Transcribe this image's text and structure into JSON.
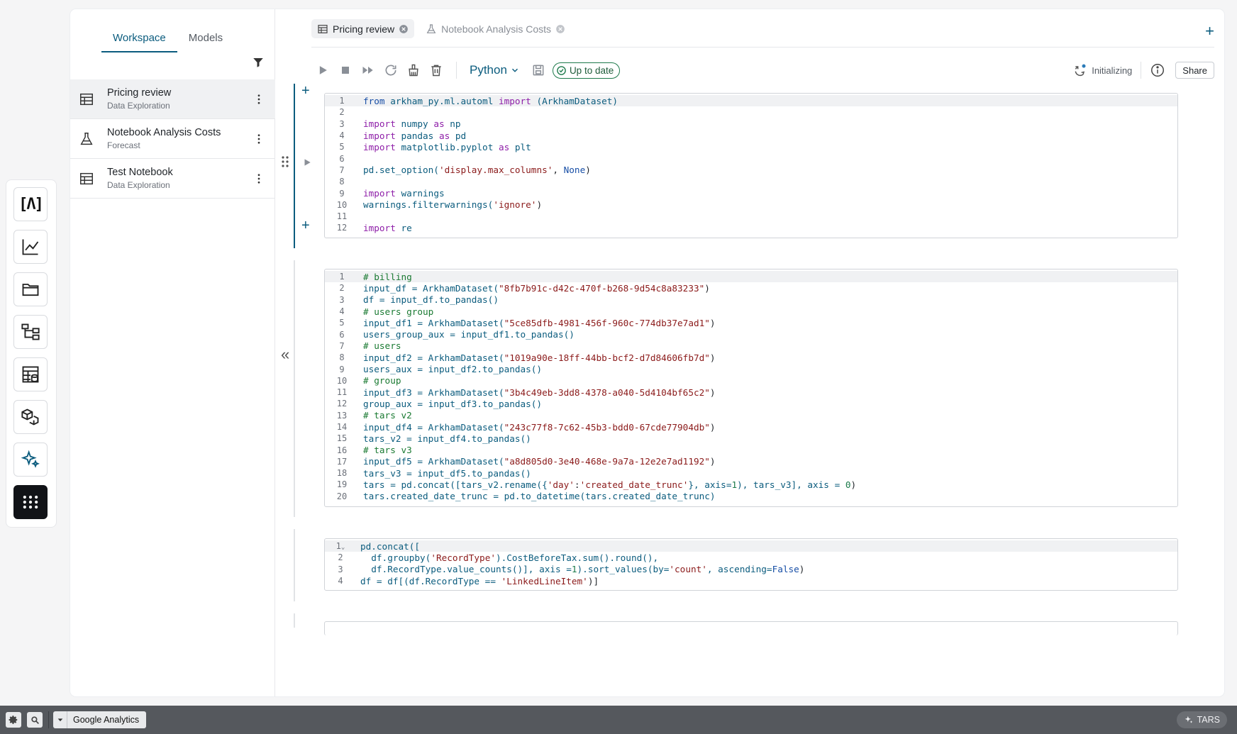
{
  "sidebar": {
    "tabs": [
      "Workspace",
      "Models"
    ],
    "notebooks": [
      {
        "title": "Pricing review",
        "subtitle": "Data Exploration",
        "icon": "table-icon"
      },
      {
        "title": "Notebook Analysis Costs",
        "subtitle": "Forecast",
        "icon": "flask-icon"
      },
      {
        "title": "Test Notebook",
        "subtitle": "Data Exploration",
        "icon": "table-icon"
      }
    ]
  },
  "tabs": [
    {
      "label": "Pricing review",
      "icon": "table-icon"
    },
    {
      "label": "Notebook Analysis Costs",
      "icon": "flask-icon"
    }
  ],
  "toolbar": {
    "language": "Python",
    "status": "Up to date",
    "kernel_status": "Initializing",
    "share_label": "Share"
  },
  "cells": [
    {
      "lines": [
        "1",
        "2",
        "3",
        "4",
        "5",
        "6",
        "7",
        "8",
        "9",
        "10",
        "11",
        "12"
      ]
    },
    {
      "lines": [
        "1",
        "2",
        "3",
        "4",
        "5",
        "6",
        "7",
        "8",
        "9",
        "10",
        "11",
        "12",
        "13",
        "14",
        "15",
        "16",
        "17",
        "18",
        "19",
        "20"
      ]
    },
    {
      "lines": [
        "1",
        "2",
        "3",
        "4"
      ]
    }
  ],
  "code": {
    "c1": {
      "l1": {
        "a": "from",
        "b": " arkham_py.ml.automl ",
        "c": "import",
        "d": " (ArkhamDataset)"
      },
      "l3": {
        "a": "import",
        "b": " numpy ",
        "c": "as",
        "d": " np"
      },
      "l4": {
        "a": "import",
        "b": " pandas ",
        "c": "as",
        "d": " pd"
      },
      "l5": {
        "a": "import",
        "b": " matplotlib.pyplot ",
        "c": "as",
        "d": " plt"
      },
      "l7": {
        "a": "pd.set_option(",
        "b": "'display.max_columns'",
        "c": ", ",
        "d": "None",
        "e": ")"
      },
      "l9": {
        "a": "import",
        "b": " warnings"
      },
      "l10": {
        "a": "warnings.filterwarnings(",
        "b": "'ignore'",
        "c": ")"
      },
      "l12": {
        "a": "import",
        "b": " re"
      }
    },
    "c2": {
      "l1": "# billing",
      "l2": {
        "a": "input_df = ArkhamDataset(",
        "b": "\"8fb7b91c-d42c-470f-b268-9d54c8a83233\"",
        "c": ")"
      },
      "l3": "df = input_df.to_pandas()",
      "l4": "# users group",
      "l5": {
        "a": "input_df1 = ArkhamDataset(",
        "b": "\"5ce85dfb-4981-456f-960c-774db37e7ad1\"",
        "c": ")"
      },
      "l6": "users_group_aux = input_df1.to_pandas()",
      "l7": "# users",
      "l8": {
        "a": "input_df2 = ArkhamDataset(",
        "b": "\"1019a90e-18ff-44bb-bcf2-d7d84606fb7d\"",
        "c": ")"
      },
      "l9": "users_aux = input_df2.to_pandas()",
      "l10": "# group",
      "l11": {
        "a": "input_df3 = ArkhamDataset(",
        "b": "\"3b4c49eb-3dd8-4378-a040-5d4104bf65c2\"",
        "c": ")"
      },
      "l12": "group_aux = input_df3.to_pandas()",
      "l13": "# tars v2",
      "l14": {
        "a": "input_df4 = ArkhamDataset(",
        "b": "\"243c77f8-7c62-45b3-bdd0-67cde77904db\"",
        "c": ")"
      },
      "l15": "tars_v2 = input_df4.to_pandas()",
      "l16": "# tars v3",
      "l17": {
        "a": "input_df5 = ArkhamDataset(",
        "b": "\"a8d805d0-3e40-468e-9a7a-12e2e7ad1192\"",
        "c": ")"
      },
      "l18": "tars_v3 = input_df5.to_pandas()",
      "l19": {
        "a": "tars = pd.concat([tars_v2.rename({",
        "b": "'day'",
        "c": ":",
        "d": "'created_date_trunc'",
        "e": "}, axis=",
        "f": "1",
        "g": "), tars_v3], axis = ",
        "h": "0",
        "i": ")"
      },
      "l20": "tars.created_date_trunc = pd.to_datetime(tars.created_date_trunc)"
    },
    "c3": {
      "l1": "pd.concat([",
      "l2": {
        "a": "  df.groupby(",
        "b": "'RecordType'",
        "c": ").CostBeforeTax.sum().round(),"
      },
      "l3": {
        "a": "  df.RecordType.value_counts()], axis =",
        "b": "1",
        "c": ").sort_values(by=",
        "d": "'count'",
        "e": ", ascending=",
        "f": "False",
        "g": ")"
      },
      "l4": {
        "a": "df = df[(df.RecordType == ",
        "b": "'LinkedLineItem'",
        "c": ")]"
      }
    }
  },
  "bottom_bar": {
    "analytics_label": "Google Analytics",
    "assistant_label": "TARS"
  },
  "colors": {
    "accent": "#0b5c7e",
    "status_green": "#1e7a4c",
    "bottom_bar": "#55585d"
  }
}
